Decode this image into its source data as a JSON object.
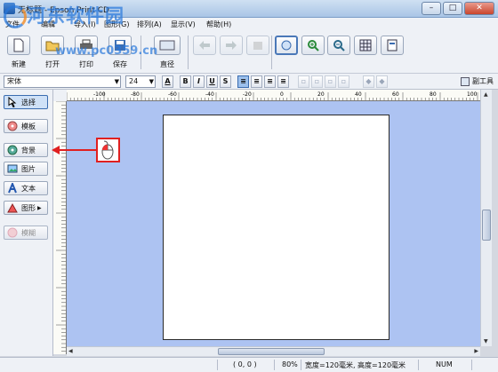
{
  "window": {
    "title": "无标题 - Epson Print CD",
    "min": "–",
    "max": "□",
    "close": "✕"
  },
  "watermark": {
    "line1": "河东软件园",
    "line2": "www.pc0359.cn"
  },
  "menu": [
    "文件",
    "编辑",
    "导入(I)",
    "图形(G)",
    "排列(A)",
    "显示(V)",
    "帮助(H)"
  ],
  "toolbar": {
    "new": "新建",
    "open": "打开",
    "print": "打印",
    "save": "保存",
    "layout": "直径"
  },
  "format": {
    "font": "宋体",
    "size": "24",
    "bold": "B",
    "italic": "I",
    "underline": "U",
    "shadow": "S",
    "subtool": "副工具"
  },
  "hruler_ticks": [
    "-100",
    "-80",
    "-60",
    "-40",
    "-20",
    "0",
    "20",
    "40",
    "60",
    "80",
    "100"
  ],
  "tools": {
    "select": "选择",
    "template": "模板",
    "background": "背景",
    "image": "图片",
    "text": "文本",
    "shape": "图形",
    "blur": "模糊"
  },
  "status": {
    "coords": "( 0, 0 )",
    "zoom": "80%",
    "size": "宽度=120毫米, 高度=120毫米",
    "num": "NUM"
  },
  "colors": {
    "canvas": "#adc3f2",
    "page": "#ffffff",
    "callout": "#e02020",
    "accent": "#3a6cb0"
  }
}
